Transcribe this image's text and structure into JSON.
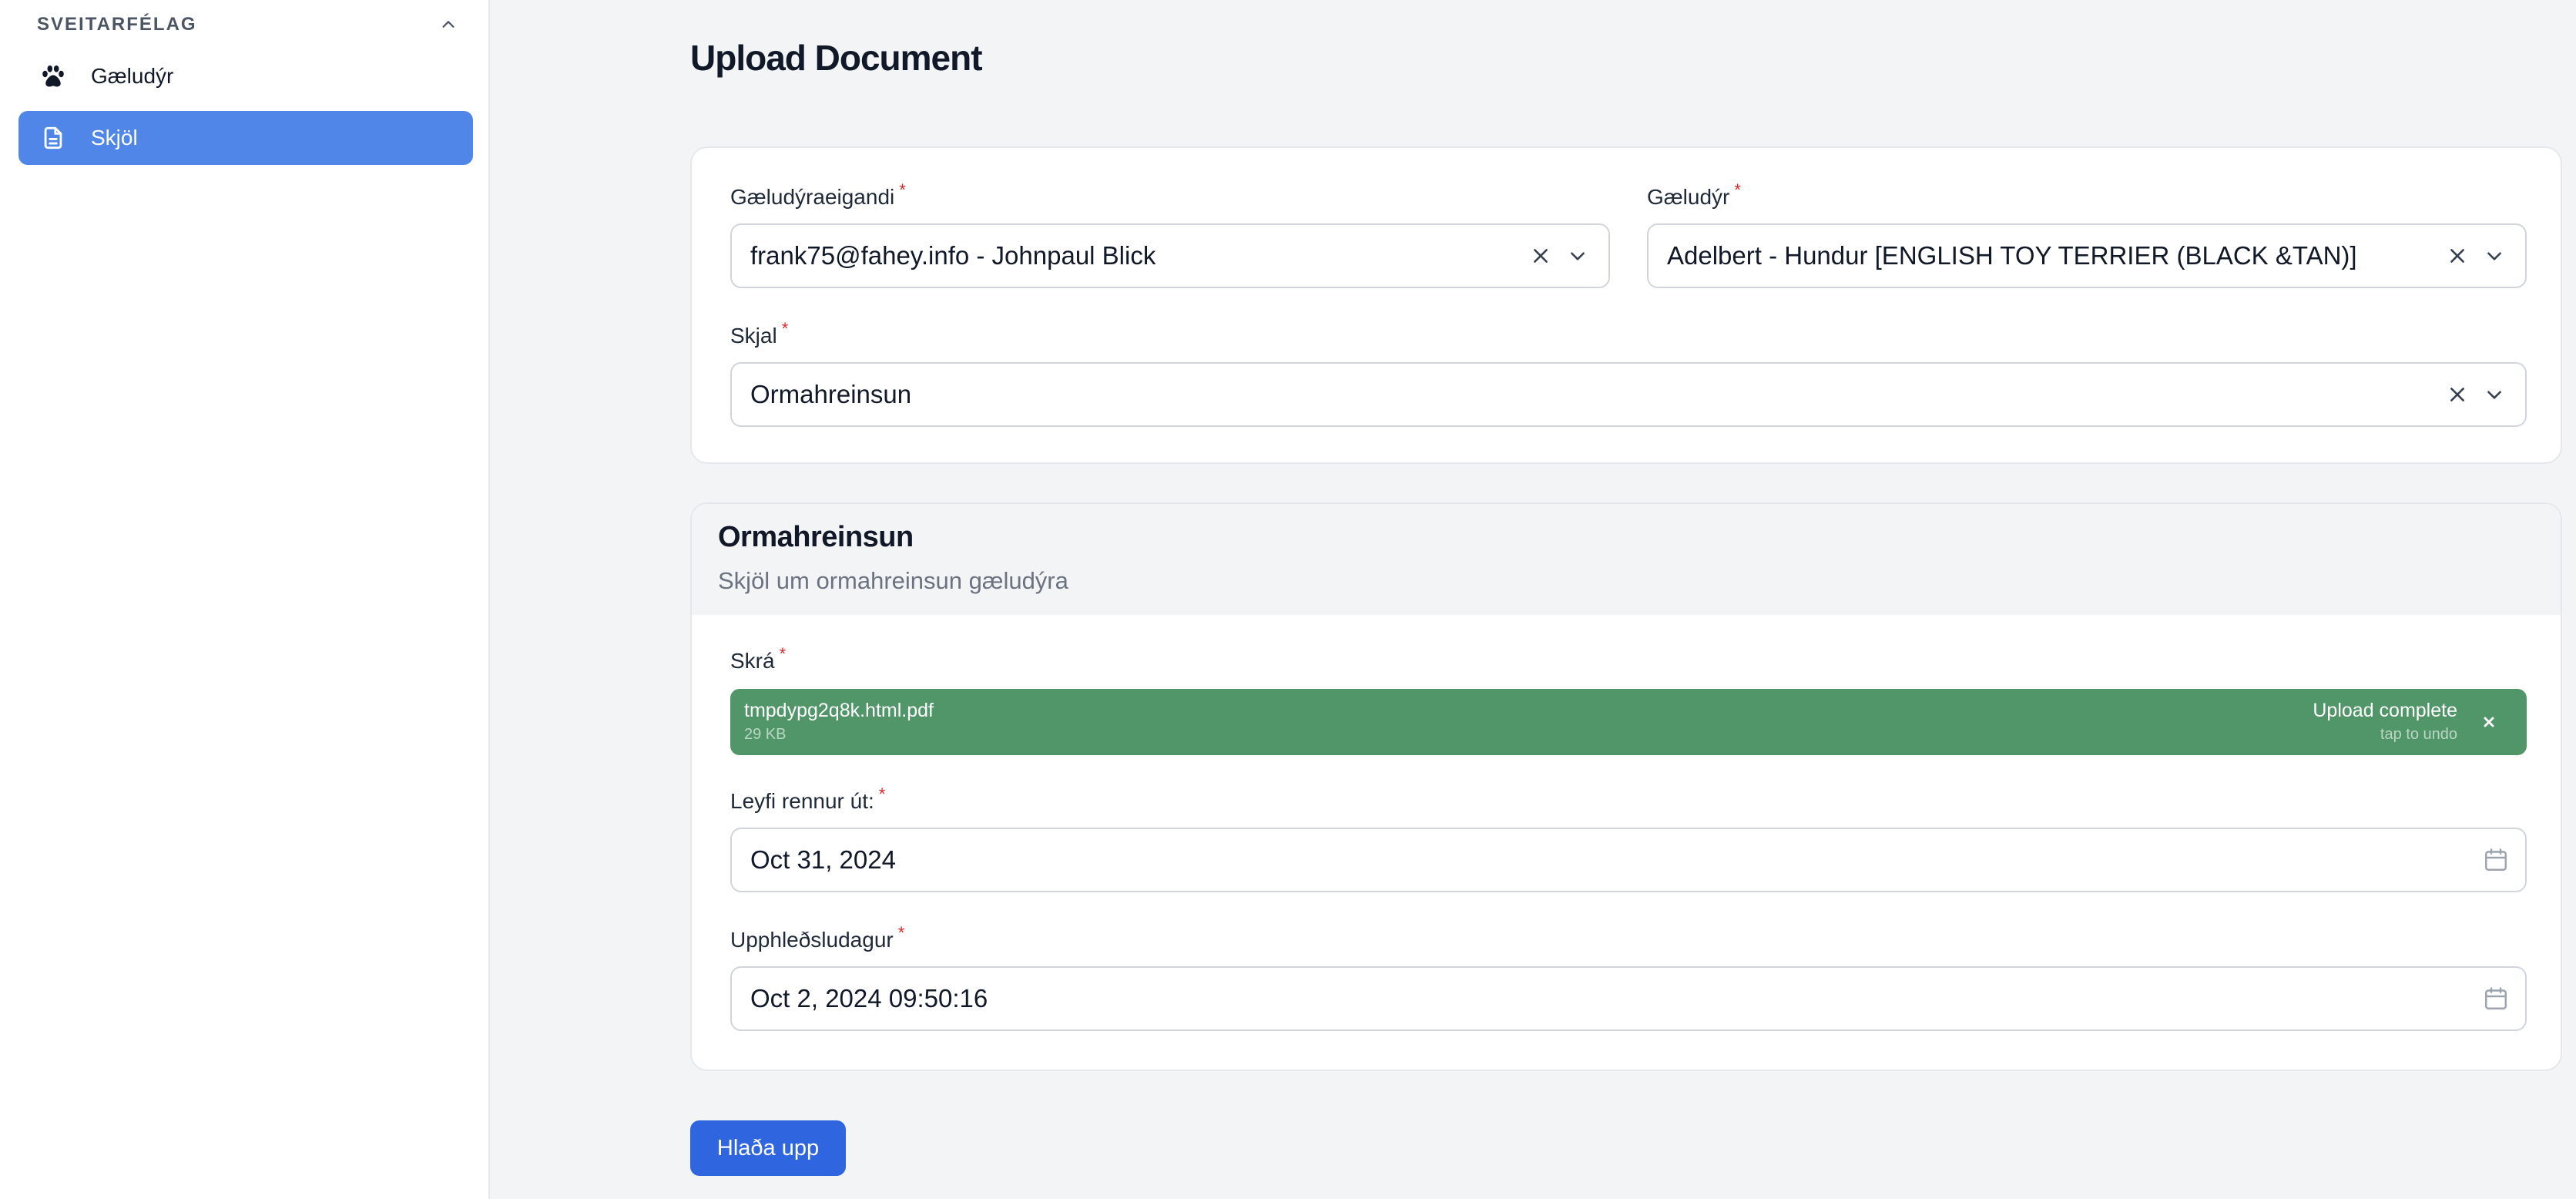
{
  "sidebar": {
    "group_label": "SVEITARFÉLAG",
    "items": [
      {
        "label": "Gæludýr",
        "icon": "paw-icon",
        "active": false
      },
      {
        "label": "Skjöl",
        "icon": "document-icon",
        "active": true
      }
    ]
  },
  "page": {
    "title": "Upload Document"
  },
  "form": {
    "owner": {
      "label": "Gæludýraeigandi",
      "value": "frank75@fahey.info - Johnpaul Blick"
    },
    "pet": {
      "label": "Gæludýr",
      "value": "Adelbert - Hundur [ENGLISH TOY TERRIER (BLACK &TAN)]"
    },
    "document": {
      "label": "Skjal",
      "value": "Ormahreinsun"
    }
  },
  "section": {
    "title": "Ormahreinsun",
    "description": "Skjöl um ormahreinsun gæludýra",
    "file": {
      "label": "Skrá",
      "name": "tmpdypg2q8k.html.pdf",
      "size": "29 KB",
      "status": "Upload complete",
      "undo": "tap to undo"
    },
    "expires": {
      "label": "Leyfi rennur út:",
      "value": "Oct 31, 2024"
    },
    "uploaded": {
      "label": "Upphleðsludagur",
      "value": "Oct 2, 2024 09:50:16"
    }
  },
  "actions": {
    "submit_label": "Hlaða upp"
  },
  "colors": {
    "accent": "#4f86e8",
    "primary_button": "#2f66e0",
    "upload_success": "#519669",
    "required": "#dc2626"
  }
}
